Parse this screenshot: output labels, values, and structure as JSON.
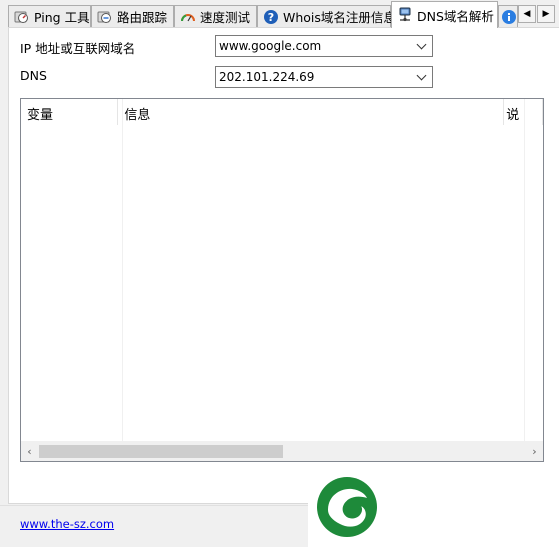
{
  "tabs": [
    {
      "label": "Ping 工具",
      "icon": "ping-tool-icon",
      "active": false
    },
    {
      "label": "路由跟踪",
      "icon": "route-trace-icon",
      "active": false
    },
    {
      "label": "速度测试",
      "icon": "speed-gauge-icon",
      "active": false
    },
    {
      "label": "Whois域名注册信息",
      "icon": "question-icon",
      "active": false
    },
    {
      "label": "DNS域名解析",
      "icon": "dns-network-icon",
      "active": true
    }
  ],
  "form": {
    "host_label": "IP 地址或互联网域名",
    "host_value": "www.google.com",
    "dns_label": "DNS",
    "dns_value": "202.101.224.69"
  },
  "table": {
    "columns": [
      "变量",
      "信息",
      "说"
    ],
    "rows": []
  },
  "footer": {
    "link_text": "www.the-sz.com"
  },
  "colors": {
    "logo_green": "#1e8a3a",
    "link_blue": "#0000ee"
  }
}
